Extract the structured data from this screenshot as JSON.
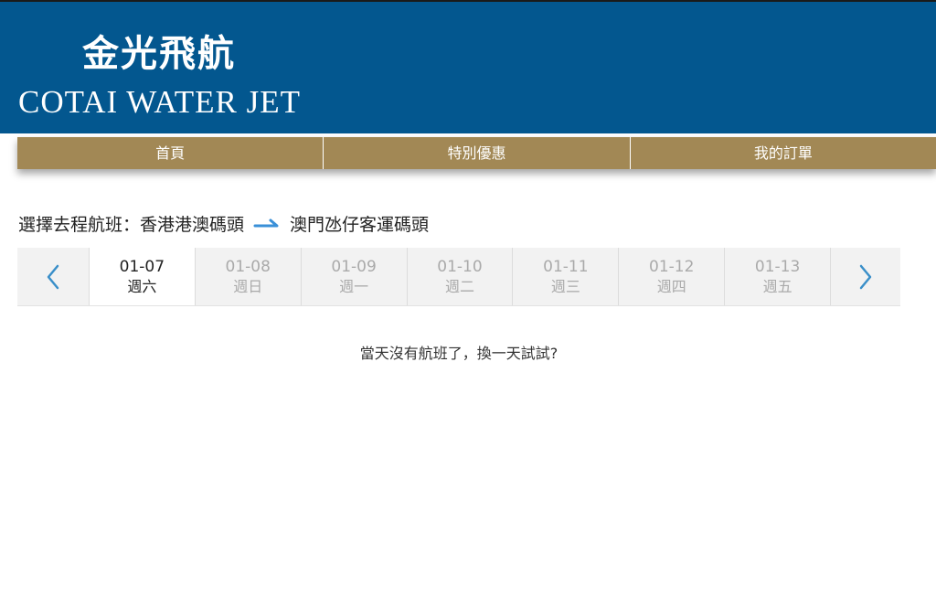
{
  "header": {
    "logo_cn": "金光飛航",
    "logo_en": "COTAI WATER JET"
  },
  "nav": {
    "items": [
      {
        "label": "首頁"
      },
      {
        "label": "特別優惠"
      },
      {
        "label": "我的訂單"
      }
    ]
  },
  "route": {
    "prefix": "選擇去程航班：",
    "from": "香港港澳碼頭",
    "to": "澳門氹仔客運碼頭",
    "arrow_color": "#3a90d8"
  },
  "dates": [
    {
      "date": "01-07",
      "weekday": "週六",
      "selected": true
    },
    {
      "date": "01-08",
      "weekday": "週日",
      "selected": false
    },
    {
      "date": "01-09",
      "weekday": "週一",
      "selected": false
    },
    {
      "date": "01-10",
      "weekday": "週二",
      "selected": false
    },
    {
      "date": "01-11",
      "weekday": "週三",
      "selected": false
    },
    {
      "date": "01-12",
      "weekday": "週四",
      "selected": false
    },
    {
      "date": "01-13",
      "weekday": "週五",
      "selected": false
    }
  ],
  "colors": {
    "header_bg": "#03578f",
    "nav_bg": "#a28855",
    "arrow_blue": "#3a8fc9"
  },
  "message": "當天沒有航班了，換一天試試?"
}
